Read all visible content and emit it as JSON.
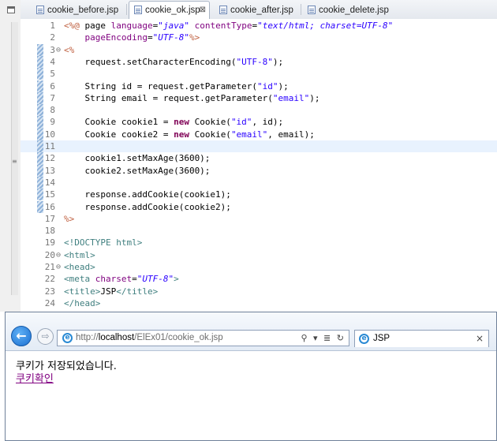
{
  "editor_tabs": [
    {
      "label": "cookie_before.jsp",
      "active": false
    },
    {
      "label": "cookie_ok.jsp",
      "active": true,
      "close": "⊠"
    },
    {
      "label": "cookie_after.jsp",
      "active": false
    },
    {
      "label": "cookie_delete.jsp",
      "active": false
    }
  ],
  "code_lines": [
    {
      "num": "1",
      "fold": "",
      "mark": false,
      "tokens": [
        [
          "dir",
          "<%@ "
        ],
        [
          "plain",
          "page "
        ],
        [
          "attr",
          "language"
        ],
        [
          "plain",
          "="
        ],
        [
          "str",
          "\"java\""
        ],
        [
          "plain",
          " "
        ],
        [
          "attr",
          "contentType"
        ],
        [
          "plain",
          "="
        ],
        [
          "str",
          "\"text/html; charset=UTF-8\""
        ]
      ]
    },
    {
      "num": "2",
      "fold": "",
      "mark": false,
      "tokens": [
        [
          "plain",
          "    "
        ],
        [
          "attr",
          "pageEncoding"
        ],
        [
          "plain",
          "="
        ],
        [
          "str",
          "\"UTF-8\""
        ],
        [
          "dir",
          "%>"
        ]
      ]
    },
    {
      "num": "3",
      "fold": "⊖",
      "mark": true,
      "tokens": [
        [
          "dir",
          "<%"
        ]
      ]
    },
    {
      "num": "4",
      "fold": "",
      "mark": true,
      "tokens": [
        [
          "plain",
          "    request.setCharacterEncoding("
        ],
        [
          "jstr",
          "\"UTF-8\""
        ],
        [
          "plain",
          ");"
        ]
      ]
    },
    {
      "num": "5",
      "fold": "",
      "mark": true,
      "tokens": []
    },
    {
      "num": "6",
      "fold": "",
      "mark": true,
      "tokens": [
        [
          "plain",
          "    String id = request.getParameter("
        ],
        [
          "jstr",
          "\"id\""
        ],
        [
          "plain",
          ");"
        ]
      ]
    },
    {
      "num": "7",
      "fold": "",
      "mark": true,
      "tokens": [
        [
          "plain",
          "    String email = request.getParameter("
        ],
        [
          "jstr",
          "\"email\""
        ],
        [
          "plain",
          ");"
        ]
      ]
    },
    {
      "num": "8",
      "fold": "",
      "mark": true,
      "tokens": []
    },
    {
      "num": "9",
      "fold": "",
      "mark": true,
      "tokens": [
        [
          "plain",
          "    Cookie cookie1 = "
        ],
        [
          "kw",
          "new"
        ],
        [
          "plain",
          " Cookie("
        ],
        [
          "jstr",
          "\"id\""
        ],
        [
          "plain",
          ", id);"
        ]
      ]
    },
    {
      "num": "10",
      "fold": "",
      "mark": true,
      "tokens": [
        [
          "plain",
          "    Cookie cookie2 = "
        ],
        [
          "kw",
          "new"
        ],
        [
          "plain",
          " Cookie("
        ],
        [
          "jstr",
          "\"email\""
        ],
        [
          "plain",
          ", email);"
        ]
      ]
    },
    {
      "num": "11",
      "fold": "",
      "mark": true,
      "highlight": true,
      "tokens": []
    },
    {
      "num": "12",
      "fold": "",
      "mark": true,
      "tokens": [
        [
          "plain",
          "    cookie1.setMaxAge(3600);"
        ]
      ]
    },
    {
      "num": "13",
      "fold": "",
      "mark": true,
      "tokens": [
        [
          "plain",
          "    cookie2.setMaxAge(3600);"
        ]
      ]
    },
    {
      "num": "14",
      "fold": "",
      "mark": true,
      "tokens": []
    },
    {
      "num": "15",
      "fold": "",
      "mark": true,
      "tokens": [
        [
          "plain",
          "    response.addCookie(cookie1);"
        ]
      ]
    },
    {
      "num": "16",
      "fold": "",
      "mark": true,
      "tokens": [
        [
          "plain",
          "    response.addCookie(cookie2);"
        ]
      ]
    },
    {
      "num": "17",
      "fold": "",
      "mark": false,
      "tokens": [
        [
          "dir",
          "%>"
        ]
      ]
    },
    {
      "num": "18",
      "fold": "",
      "mark": false,
      "tokens": []
    },
    {
      "num": "19",
      "fold": "",
      "mark": false,
      "tokens": [
        [
          "tag",
          "<!DOCTYPE html>"
        ]
      ]
    },
    {
      "num": "20",
      "fold": "⊖",
      "mark": false,
      "tokens": [
        [
          "tag",
          "<html>"
        ]
      ]
    },
    {
      "num": "21",
      "fold": "⊖",
      "mark": false,
      "tokens": [
        [
          "tag",
          "<head>"
        ]
      ]
    },
    {
      "num": "22",
      "fold": "",
      "mark": false,
      "tokens": [
        [
          "tag",
          "<meta "
        ],
        [
          "attr",
          "charset"
        ],
        [
          "plain",
          "="
        ],
        [
          "str",
          "\"UTF-8\""
        ],
        [
          "tag",
          ">"
        ]
      ]
    },
    {
      "num": "23",
      "fold": "",
      "mark": false,
      "tokens": [
        [
          "tag",
          "<title>"
        ],
        [
          "plain",
          "JSP"
        ],
        [
          "tag",
          "</title>"
        ]
      ]
    },
    {
      "num": "24",
      "fold": "",
      "mark": false,
      "tokens": [
        [
          "tag",
          "</head>"
        ]
      ]
    }
  ],
  "browser": {
    "url_prefix": "http://",
    "url_host": "localhost",
    "url_path": "/ElEx01/cookie_ok.jsp",
    "addr_tools": "⚲ ▾ ≣ ↻",
    "tab_title": "JSP",
    "tab_close": "×",
    "back_glyph": "←",
    "forward_glyph": "⇨",
    "ie_glyph": "e",
    "message": "쿠키가 저장되었습니다.",
    "link": "쿠키확인"
  },
  "icons": [
    "minimize-icon",
    "file-icon",
    "close-icon",
    "back-arrow-icon",
    "forward-arrow-icon",
    "ie-icon",
    "search-icon",
    "refresh-icon"
  ],
  "colors": {
    "jsp_directive": "#bf5f3f",
    "string": "#2a00ff",
    "keyword": "#7f0055",
    "html_tag": "#3f7f7f",
    "attribute": "#7f007f",
    "visited_link": "#800080",
    "current_line": "#e8f2fe"
  }
}
